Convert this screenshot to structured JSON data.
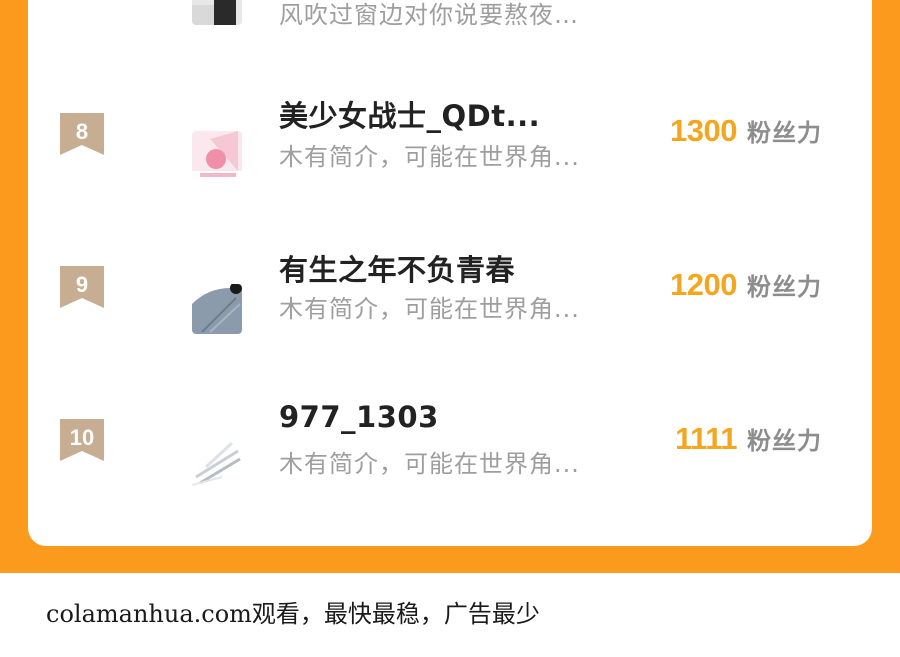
{
  "rows": [
    {
      "rank": "",
      "name": "",
      "desc": "风吹过窗边对你说要熬夜…",
      "fans": "",
      "unit": ""
    },
    {
      "rank": "8",
      "name": "美少女战士_QDt...",
      "desc": "木有简介，可能在世界角...",
      "fans": "1300",
      "unit": "粉丝力"
    },
    {
      "rank": "9",
      "name": "有生之年不负青春",
      "desc": "木有简介，可能在世界角...",
      "fans": "1200",
      "unit": "粉丝力"
    },
    {
      "rank": "10",
      "name": "977_1303",
      "desc": "木有简介，可能在世界角...",
      "fans": "1111",
      "unit": "粉丝力"
    }
  ],
  "footer": "colamanhua.com观看，最快最稳，广告最少",
  "colors": {
    "background_orange": "#fc9a1e",
    "fans_number": "#f4a61e",
    "rank_badge": "#c7ae93",
    "name": "#222222",
    "desc": "#9e9e9e"
  }
}
